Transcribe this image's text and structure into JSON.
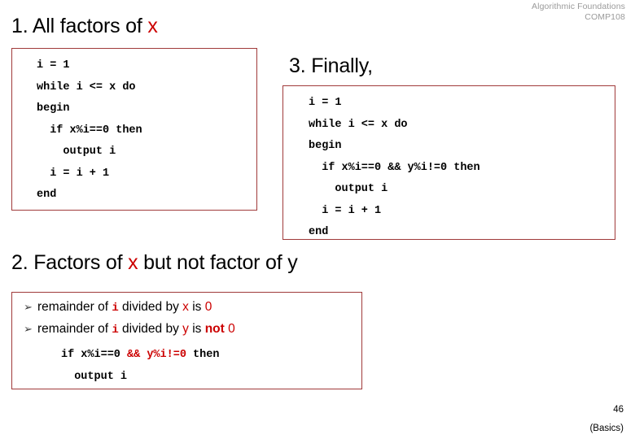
{
  "header": {
    "course_title": "Algorithmic Foundations",
    "course_code": "COMP108"
  },
  "sections": {
    "one": {
      "heading_prefix": "1. All factors of ",
      "heading_var": "x",
      "code": "i = 1\nwhile i <= x do\nbegin\n  if x%i==0 then\n    output i\n  i = i + 1\nend"
    },
    "two": {
      "heading_prefix": "2. Factors of ",
      "heading_var": "x",
      "heading_suffix": " but not factor of y",
      "bullets": [
        {
          "marker": "➢",
          "p1": "remainder of ",
          "v1": "i",
          "p2": " divided by ",
          "v2": "x",
          "p3": " is ",
          "v3": "0",
          "emph": "",
          "p4": ""
        },
        {
          "marker": "➢",
          "p1": "remainder of ",
          "v1": "i",
          "p2": " divided by ",
          "v2": "y",
          "p3": " is ",
          "emph": "not",
          "p4": " ",
          "v3": "0"
        }
      ],
      "code_line1_black": "if x%i==0 ",
      "code_line1_red": "&& y%i!=0",
      "code_line1_black2": " then",
      "code_line2": "  output i"
    },
    "three": {
      "heading": "3. Finally,",
      "code": "i = 1\nwhile i <= x do\nbegin\n  if x%i==0 && y%i!=0 then\n    output i\n  i = i + 1\nend"
    }
  },
  "footer": {
    "page_number": "46",
    "deck_label": "(Basics)"
  },
  "colors": {
    "accent_red": "#cc0000",
    "box_border": "#a03a3a",
    "header_gray": "#9a9a9a"
  }
}
